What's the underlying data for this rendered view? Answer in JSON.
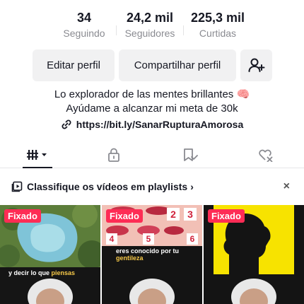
{
  "stats": [
    {
      "value": "34",
      "label": "Seguindo"
    },
    {
      "value": "24,2 mil",
      "label": "Seguidores"
    },
    {
      "value": "225,3 mil",
      "label": "Curtidas"
    }
  ],
  "actions": {
    "edit_label": "Editar perfil",
    "share_label": "Compartilhar perfil",
    "add_friend_icon": "add-user-icon"
  },
  "bio": {
    "line1": "Lo explorador de las mentes brillantes 🧠",
    "line2": "Ayúdame a alcanzar mi meta de 30k"
  },
  "link": {
    "icon": "link-icon",
    "url": "https://bit.ly/SanarRupturaAmorosa"
  },
  "tabs": [
    {
      "icon": "videos-grid-icon",
      "active": true
    },
    {
      "icon": "lock-icon",
      "active": false
    },
    {
      "icon": "saved-icon",
      "active": false
    },
    {
      "icon": "liked-icon",
      "active": false
    }
  ],
  "playlist_banner": {
    "icon": "playlist-icon",
    "text": "Classifique os vídeos em playlists",
    "chevron": "›",
    "close": "×"
  },
  "videos": [
    {
      "pinned_label": "Fixado",
      "caption_prefix": "y decir lo que ",
      "caption_highlight": "piensas"
    },
    {
      "pinned_label": "Fixado",
      "caption_prefix": "eres conocido por tu ",
      "caption_highlight": "gentileza",
      "numbers": [
        "2",
        "3",
        "4",
        "5",
        "6"
      ]
    },
    {
      "pinned_label": "Fixado"
    }
  ],
  "colors": {
    "accent": "#fe2c55",
    "text": "#161823",
    "muted": "#8a8b91",
    "button_bg": "#f1f1f2",
    "highlight": "#f7c948",
    "yellow_panel": "#f7e300"
  }
}
